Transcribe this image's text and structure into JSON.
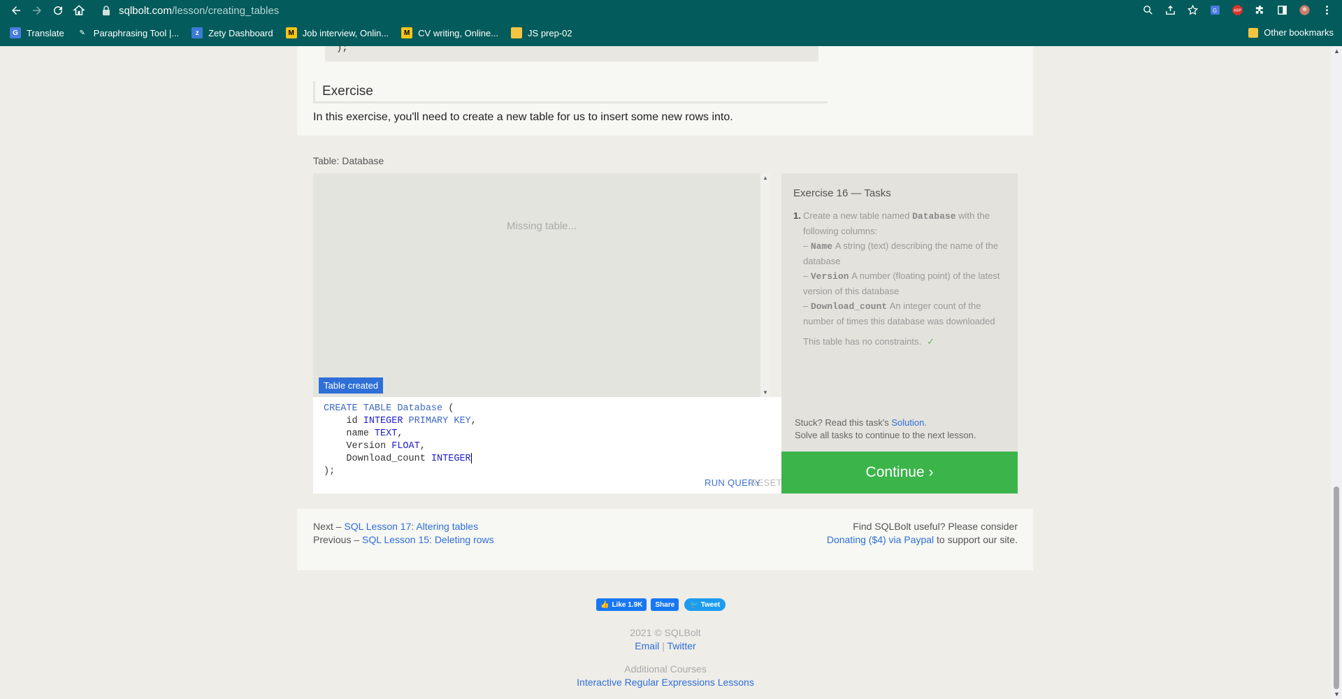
{
  "browser": {
    "url_host": "sqlbolt.com",
    "url_path": "/lesson/creating_tables",
    "bookmarks": [
      {
        "label": "Translate",
        "icon": "google-translate-icon",
        "color": "#4a7be0"
      },
      {
        "label": "Paraphrasing Tool |...",
        "icon": "pen-icon",
        "color": "#f0f0f0"
      },
      {
        "label": "Zety Dashboard",
        "icon": "zety-icon",
        "color": "#3a7bd5"
      },
      {
        "label": "Job interview, Onlin...",
        "icon": "m-logo-icon",
        "color": "#f5c518"
      },
      {
        "label": "CV writing, Online...",
        "icon": "m-logo-icon",
        "color": "#f5c518"
      },
      {
        "label": "JS prep-02",
        "icon": "folder-icon",
        "color": "#f5c542"
      }
    ],
    "other_bookmarks": "Other bookmarks"
  },
  "lesson": {
    "code_tail": ");",
    "exercise_heading": "Exercise",
    "exercise_intro": "In this exercise, you'll need to create a new table for us to insert some new rows into.",
    "table_label": "Table: Database",
    "missing_table": "Missing table...",
    "status_badge": "Table created",
    "run_query": "RUN QUERY",
    "reset": "RESET"
  },
  "tasks": {
    "title": "Exercise 16 — Tasks",
    "number": "1.",
    "intro_prefix": "Create a new table named",
    "table_name": "Database",
    "intro_suffix": "with the following columns:",
    "columns": [
      {
        "name": "Name",
        "desc": "A string (text) describing the name of the database"
      },
      {
        "name": "Version",
        "desc": "A number (floating point) of the latest version of this database"
      },
      {
        "name": "Download_count",
        "desc": "An integer count of the number of times this database was downloaded"
      }
    ],
    "constraints": "This table has no constraints.",
    "check": "✓",
    "stuck_prefix": "Stuck? Read this task's",
    "solution_link": "Solution",
    "stuck_suffix": "Solve all tasks to continue to the next lesson.",
    "continue": "Continue ›"
  },
  "footer_nav": {
    "next_prefix": "Next –",
    "next_link": "SQL Lesson 17: Altering tables",
    "prev_prefix": "Previous –",
    "prev_link": "SQL Lesson 15: Deleting rows",
    "support_text": "Find SQLBolt useful? Please consider",
    "donate_link": "Donating ($4) via Paypal",
    "support_suffix": "to support our site."
  },
  "social": {
    "like": "Like 1.9K",
    "share": "Share",
    "tweet": "Tweet"
  },
  "site_footer": {
    "copyright": "2021 © SQLBolt",
    "email": "Email",
    "separator": "|",
    "twitter": "Twitter",
    "additional": "Additional Courses",
    "regex_link": "Interactive Regular Expressions Lessons"
  },
  "colors": {
    "chrome": "#035b5b",
    "accent_blue": "#2e6fd8",
    "continue_green": "#3bb44a"
  }
}
